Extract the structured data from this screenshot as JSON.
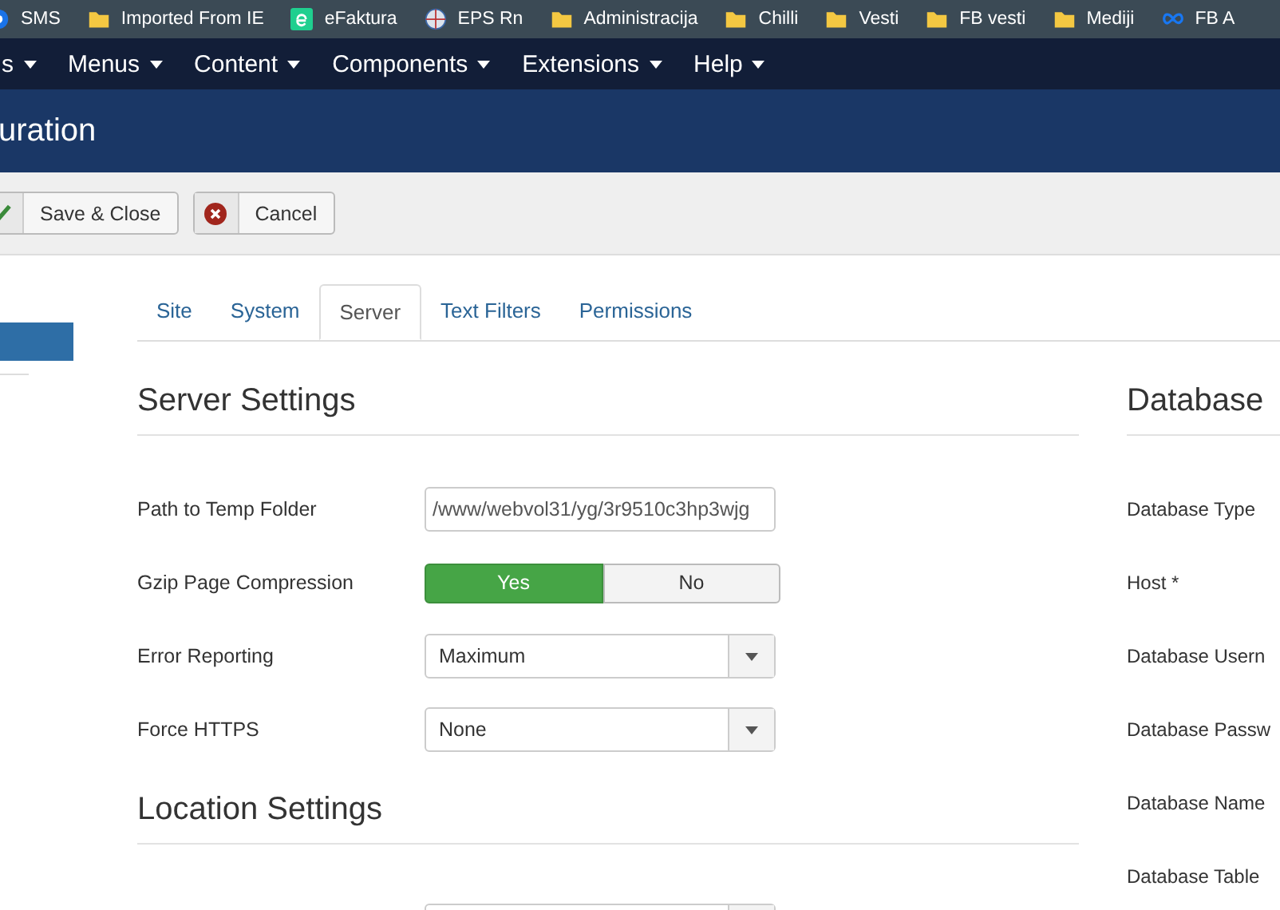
{
  "bookmarks": [
    {
      "label": "SMS",
      "kind": "chat"
    },
    {
      "label": "Imported From IE",
      "kind": "folder"
    },
    {
      "label": "eFaktura",
      "kind": "app"
    },
    {
      "label": "EPS Rn",
      "kind": "globe"
    },
    {
      "label": "Administracija",
      "kind": "folder"
    },
    {
      "label": "Chilli",
      "kind": "folder"
    },
    {
      "label": "Vesti",
      "kind": "folder"
    },
    {
      "label": "FB vesti",
      "kind": "folder"
    },
    {
      "label": "Mediji",
      "kind": "folder"
    },
    {
      "label": "FB A",
      "kind": "meta"
    }
  ],
  "menu": [
    {
      "label": "s"
    },
    {
      "label": "Menus"
    },
    {
      "label": "Content"
    },
    {
      "label": "Components"
    },
    {
      "label": "Extensions"
    },
    {
      "label": "Help"
    }
  ],
  "page_title": "uration",
  "toolbar": [
    {
      "label": "Save & Close",
      "kind": "save"
    },
    {
      "label": "Cancel",
      "kind": "cancel"
    }
  ],
  "tabs": [
    {
      "label": "Site",
      "selected": false
    },
    {
      "label": "System",
      "selected": false
    },
    {
      "label": "Server",
      "selected": true
    },
    {
      "label": "Text Filters",
      "selected": false
    },
    {
      "label": "Permissions",
      "selected": false
    }
  ],
  "server_settings": {
    "title": "Server Settings",
    "fields": [
      {
        "label": "Path to Temp Folder",
        "kind": "text",
        "value": "/www/webvol31/yg/3r9510c3hp3wjg"
      },
      {
        "label": "Gzip Page Compression",
        "kind": "toggle",
        "options": [
          {
            "label": "Yes",
            "selected": true
          },
          {
            "label": "No",
            "selected": false
          }
        ]
      },
      {
        "label": "Error Reporting",
        "kind": "select",
        "value": "Maximum"
      },
      {
        "label": "Force HTTPS",
        "kind": "select",
        "value": "None"
      }
    ]
  },
  "location_settings": {
    "title": "Location Settings",
    "fields": [
      {
        "kind": "select"
      }
    ]
  },
  "database_settings": {
    "title": "Database",
    "fields": [
      {
        "label": "Database Type"
      },
      {
        "label": "Host *"
      },
      {
        "label": "Database Usern"
      },
      {
        "label": "Database Passw"
      },
      {
        "label": "Database Name"
      },
      {
        "label": "Database Table"
      }
    ]
  }
}
